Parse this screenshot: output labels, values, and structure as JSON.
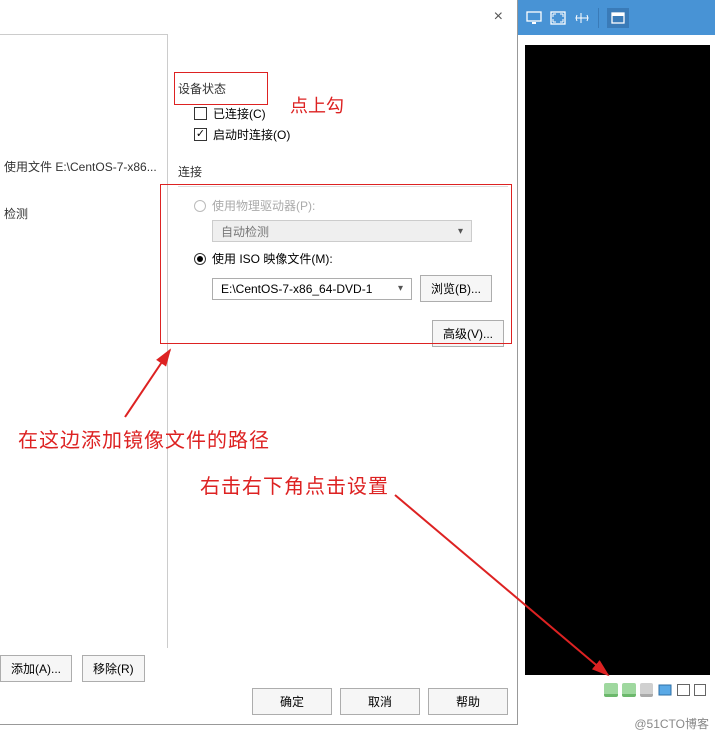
{
  "dialog": {
    "close": "×",
    "left": {
      "item_file": "使用文件 E:\\CentOS-7-x86...",
      "item_detect": "检测",
      "add_btn": "添加(A)...",
      "remove_btn": "移除(R)"
    },
    "device_status": {
      "title": "设备状态",
      "connected_label": "已连接(C)",
      "connected_checked": false,
      "connect_power_label": "启动时连接(O)",
      "connect_power_checked": true
    },
    "connection": {
      "title": "连接",
      "physical_label": "使用物理驱动器(P):",
      "physical_select": "自动检测",
      "iso_label": "使用 ISO 映像文件(M):",
      "iso_value": "E:\\CentOS-7-x86_64-DVD-1",
      "browse_btn": "浏览(B)...",
      "advanced_btn": "高级(V)..."
    },
    "buttons": {
      "ok": "确定",
      "cancel": "取消",
      "help": "帮助"
    }
  },
  "annotations": {
    "check_hint": "点上勾",
    "path_hint": "在这边添加镜像文件的路径",
    "click_hint": "右击右下角点击设置"
  },
  "watermark": "@51CTO博客"
}
